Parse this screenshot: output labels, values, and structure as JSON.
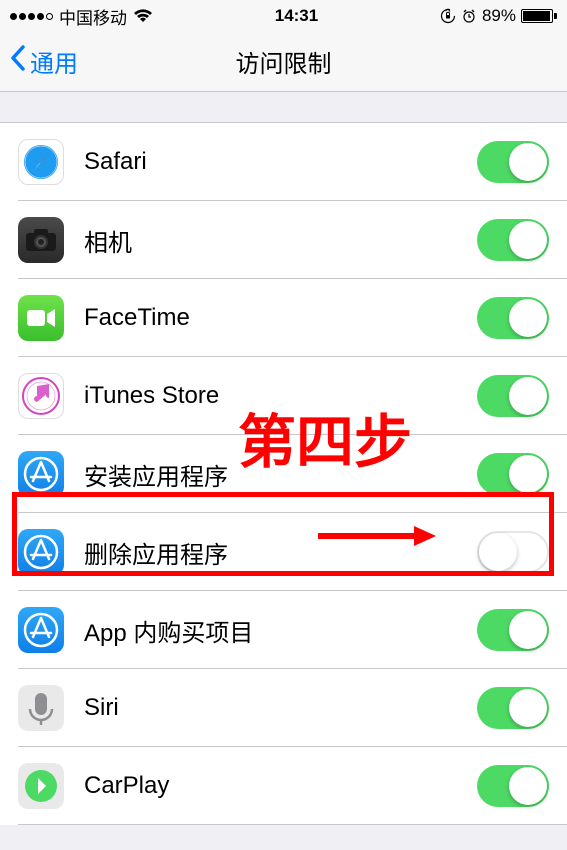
{
  "status_bar": {
    "carrier": "中国移动",
    "time": "14:31",
    "battery_pct": "89%"
  },
  "nav": {
    "back_label": "通用",
    "title": "访问限制"
  },
  "rows": [
    {
      "icon": "safari",
      "label": "Safari",
      "on": true
    },
    {
      "icon": "camera",
      "label": "相机",
      "on": true
    },
    {
      "icon": "facetime",
      "label": "FaceTime",
      "on": true
    },
    {
      "icon": "itunes",
      "label": "iTunes Store",
      "on": true
    },
    {
      "icon": "appstore",
      "label": "安装应用程序",
      "on": true
    },
    {
      "icon": "appstore",
      "label": "删除应用程序",
      "on": false
    },
    {
      "icon": "appstore",
      "label": "App 内购买项目",
      "on": true
    },
    {
      "icon": "siri",
      "label": "Siri",
      "on": true
    },
    {
      "icon": "carplay",
      "label": "CarPlay",
      "on": true
    }
  ],
  "annotation": {
    "text": "第四步"
  }
}
